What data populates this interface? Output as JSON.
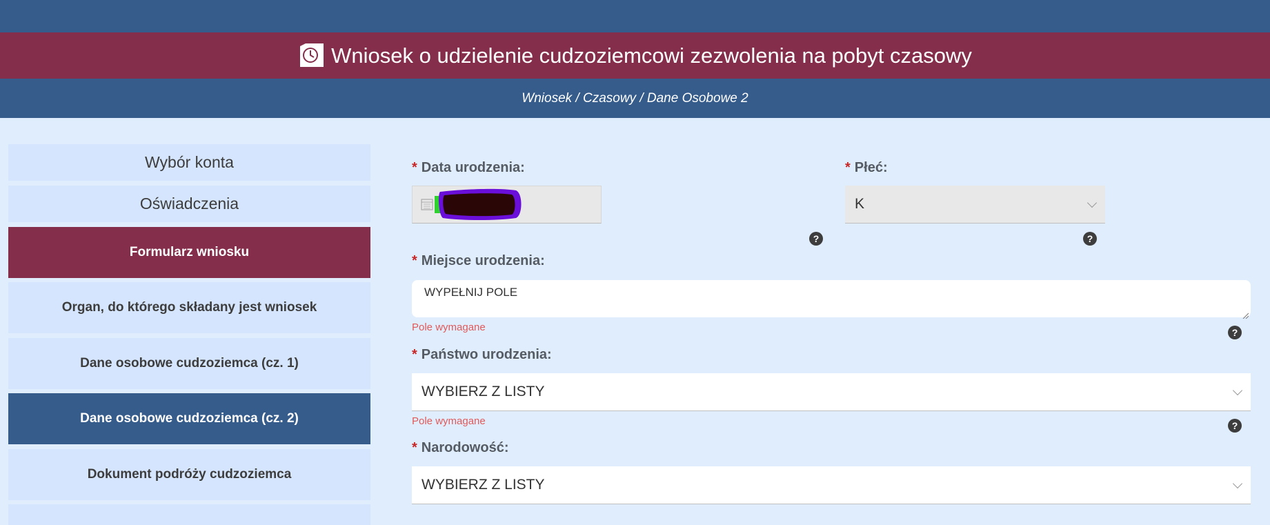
{
  "header": {
    "title": "Wniosek o udzielenie cudzoziemcowi zezwolenia na pobyt czasowy",
    "icon": "clock-document-icon",
    "breadcrumb": "Wniosek / Czasowy / Dane Osobowe 2"
  },
  "sidebar": {
    "items": [
      {
        "label": "Wybór konta"
      },
      {
        "label": "Oświadczenia"
      },
      {
        "label": "Formularz wniosku"
      },
      {
        "label": "Organ, do którego składany jest wniosek"
      },
      {
        "label": "Dane osobowe cudzoziemca (cz. 1)"
      },
      {
        "label": "Dane osobowe cudzoziemca (cz. 2)"
      },
      {
        "label": "Dokument podróży cudzoziemca"
      }
    ]
  },
  "form": {
    "required_mark": "*",
    "help_symbol": "?",
    "birth_date": {
      "label": "Data urodzenia:",
      "value": ""
    },
    "sex": {
      "label": "Płeć:",
      "value": "K"
    },
    "birth_place": {
      "label": "Miejsce urodzenia:",
      "value": "WYPEŁNIJ POLE",
      "error": "Pole wymagane"
    },
    "birth_country": {
      "label": "Państwo urodzenia:",
      "value": "WYBIERZ Z LISTY",
      "error": "Pole wymagane"
    },
    "nationality": {
      "label": "Narodowość:",
      "value": "WYBIERZ Z LISTY"
    }
  },
  "colors": {
    "blue_bar": "#365c8c",
    "red_bar": "#852e4b",
    "page_bg": "#e0edfd",
    "sidebar_item": "#d4e5fd",
    "required": "#c62828",
    "error_text": "#e05a5a"
  }
}
